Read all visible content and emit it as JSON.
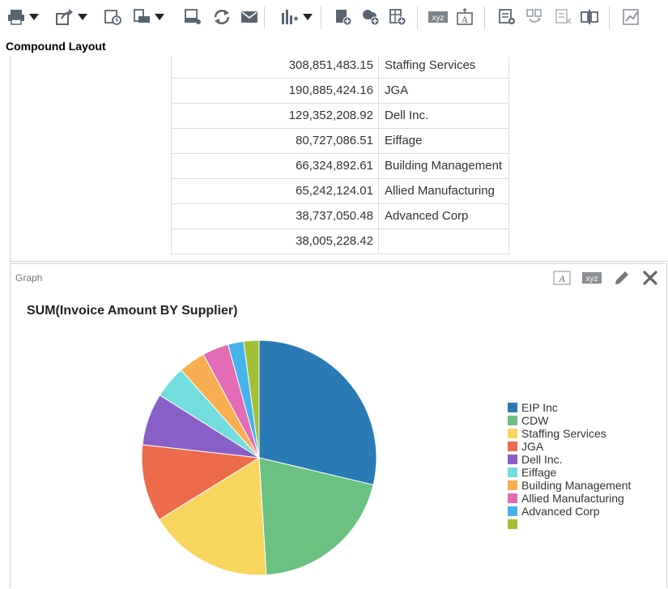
{
  "toolbar": {
    "items": [
      {
        "icon": "print-icon",
        "dropdown": true
      },
      {
        "icon": "export-icon",
        "dropdown": true
      },
      {
        "icon": "schedule-icon",
        "dropdown": false
      },
      {
        "icon": "print-options-icon",
        "dropdown": true
      },
      {
        "icon": "offline-icon",
        "dropdown": false
      },
      {
        "icon": "refresh-icon",
        "dropdown": false
      },
      {
        "icon": "email-icon",
        "dropdown": false
      },
      {
        "icon": "insert-chart-icon",
        "dropdown": true
      },
      {
        "icon": "add-table-icon",
        "dropdown": false
      },
      {
        "icon": "add-view-icon",
        "dropdown": false
      },
      {
        "icon": "add-pivot-icon",
        "dropdown": false
      },
      {
        "icon": "narrative-icon",
        "dropdown": false
      },
      {
        "icon": "title-icon",
        "dropdown": false
      },
      {
        "icon": "layout-add-icon",
        "dropdown": false
      },
      {
        "icon": "layout-swap-icon",
        "dropdown": false
      },
      {
        "icon": "layout-remove-icon",
        "dropdown": false
      },
      {
        "icon": "layout-split-icon",
        "dropdown": false
      },
      {
        "icon": "graph-properties-icon",
        "dropdown": false
      }
    ],
    "xyz_label": "xyz",
    "title_glyph": "A"
  },
  "layout_title": "Compound Layout",
  "table": {
    "rows": [
      {
        "amount": "308,851,483.15",
        "supplier": "Staffing Services"
      },
      {
        "amount": "190,885,424.16",
        "supplier": "JGA"
      },
      {
        "amount": "129,352,208.92",
        "supplier": "Dell Inc."
      },
      {
        "amount": "80,727,086.51",
        "supplier": "Eiffage"
      },
      {
        "amount": "66,324,892.61",
        "supplier": "Building Management"
      },
      {
        "amount": "65,242,124.01",
        "supplier": "Allied Manufacturing"
      },
      {
        "amount": "38,737,050.48",
        "supplier": "Advanced Corp"
      },
      {
        "amount": "38,005,228.42",
        "supplier": ""
      }
    ]
  },
  "graph_panel": {
    "label": "Graph",
    "tools": {
      "xyz_label": "xyz",
      "title_glyph": "A"
    }
  },
  "chart_data": {
    "type": "pie",
    "title": "SUM(Invoice Amount BY Supplier)",
    "slices": [
      {
        "label": "EIP Inc",
        "value": 517,
        "color": "#2a7ab5"
      },
      {
        "label": "CDW",
        "value": 366,
        "color": "#6ac182"
      },
      {
        "label": "Staffing Services",
        "value": 308.85,
        "color": "#f8d55f"
      },
      {
        "label": "JGA",
        "value": 190.89,
        "color": "#ec6b4b"
      },
      {
        "label": "Dell Inc.",
        "value": 129.35,
        "color": "#8860c8"
      },
      {
        "label": "Eiffage",
        "value": 80.73,
        "color": "#73dcdc"
      },
      {
        "label": "Building Management",
        "value": 66.32,
        "color": "#f9ae51"
      },
      {
        "label": "Allied Manufacturing",
        "value": 65.24,
        "color": "#e36bb5"
      },
      {
        "label": "Advanced Corp",
        "value": 38.74,
        "color": "#45b3ea"
      },
      {
        "label": "",
        "value": 38.01,
        "color": "#a2c037"
      }
    ],
    "value_units": "millions",
    "legend_position": "right"
  }
}
